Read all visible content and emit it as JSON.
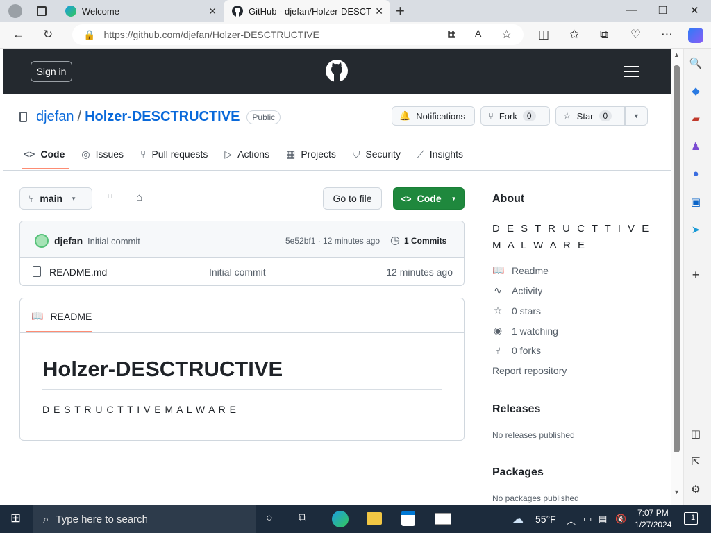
{
  "browser": {
    "tabs": [
      {
        "title": "Welcome",
        "active": false
      },
      {
        "title": "GitHub - djefan/Holzer-DESCTRU",
        "active": true
      }
    ],
    "new_tab": "+",
    "url": "https://github.com/djefan/Holzer-DESCTRUCTIVE"
  },
  "gh_header": {
    "signin_label": "Sign in"
  },
  "repo": {
    "owner": "djefan",
    "separator": "/",
    "name": "Holzer-DESCTRUCTIVE",
    "visibility": "Public",
    "notifications_label": "Notifications",
    "fork_label": "Fork",
    "fork_count": "0",
    "star_label": "Star",
    "star_count": "0",
    "tabs": [
      {
        "label": "Code",
        "icon": "code-icon"
      },
      {
        "label": "Issues",
        "icon": "issues-icon"
      },
      {
        "label": "Pull requests",
        "icon": "pull-request-icon"
      },
      {
        "label": "Actions",
        "icon": "actions-icon"
      },
      {
        "label": "Projects",
        "icon": "projects-icon"
      },
      {
        "label": "Security",
        "icon": "shield-icon"
      },
      {
        "label": "Insights",
        "icon": "graph-icon"
      }
    ]
  },
  "toolbar": {
    "branch": "main",
    "go_to_file": "Go to file",
    "code_label": "Code"
  },
  "commit": {
    "author": "djefan",
    "message": "Initial commit",
    "sha_time": "5e52bf1 · 12 minutes ago",
    "commits_label": "1 Commits"
  },
  "files": [
    {
      "name": "README.md",
      "message": "Initial commit",
      "time": "12 minutes ago"
    }
  ],
  "readme": {
    "tab_label": "README",
    "heading": "Holzer-DESCTRUCTIVE",
    "body": "D E S T R U C T T I V E M A L W A R E"
  },
  "about": {
    "title": "About",
    "description": "D E S T R U C T T I V E M A L W A R E",
    "links": [
      {
        "label": "Readme",
        "icon": "book-icon"
      },
      {
        "label": "Activity",
        "icon": "pulse-icon"
      },
      {
        "label": "0 stars",
        "icon": "star-icon"
      },
      {
        "label": "1 watching",
        "icon": "eye-icon"
      },
      {
        "label": "0 forks",
        "icon": "fork-icon"
      }
    ],
    "report": "Report repository",
    "releases_title": "Releases",
    "releases_text": "No releases published",
    "packages_title": "Packages",
    "packages_text": "No packages published"
  },
  "taskbar": {
    "search_placeholder": "Type here to search",
    "weather": "55°F",
    "time": "7:07 PM",
    "date": "1/27/2024",
    "notifications_count": "1"
  }
}
